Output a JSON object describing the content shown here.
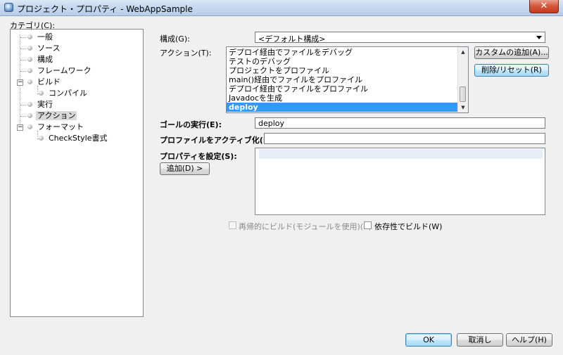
{
  "window": {
    "title": "プロジェクト・プロパティ - WebAppSample",
    "close_glyph": "✕"
  },
  "categories": {
    "label": "カテゴリ(C):",
    "items": [
      {
        "label": "一般"
      },
      {
        "label": "ソース"
      },
      {
        "label": "構成"
      },
      {
        "label": "フレームワーク"
      },
      {
        "label": "ビルド"
      },
      {
        "label": "コンパイル"
      },
      {
        "label": "実行"
      },
      {
        "label": "アクション",
        "selected": true
      },
      {
        "label": "フォーマット"
      },
      {
        "label": "CheckStyle書式"
      }
    ]
  },
  "config": {
    "label": "構成(G):",
    "value": "<デフォルト構成>"
  },
  "actions": {
    "label": "アクション(T):",
    "items": [
      "デプロイ経由でファイルをデバッグ",
      "テストのデバッグ",
      "プロジェクトをプロファイル",
      "main()経由でファイルをプロファイル",
      "デプロイ経由でファイルをプロファイル",
      "Javadocを生成",
      "deploy"
    ],
    "selected": "deploy",
    "add_custom_button": "カスタムの追加(A)...",
    "remove_reset_button": "削除/リセット(R)"
  },
  "goal": {
    "label": "ゴールの実行(E):",
    "value": "deploy"
  },
  "profiles": {
    "label": "プロファイルをアクティブ化(P):",
    "value": ""
  },
  "properties": {
    "label": "プロパティを設定(S):",
    "add_button": "追加(D) >"
  },
  "options": {
    "recursive_build": {
      "label": "再帰的にビルド(モジュールを使用)(B)",
      "checked": false,
      "enabled": false
    },
    "build_with_deps": {
      "label": "依存性でビルド(W)",
      "checked": false,
      "enabled": true
    }
  },
  "footer": {
    "ok": "OK",
    "cancel": "取消し",
    "help": "ヘルプ(H)"
  },
  "colors": {
    "selection": "#3399ff",
    "tree_selection": "#d9d9d9",
    "close_button": "#c23a1e"
  }
}
